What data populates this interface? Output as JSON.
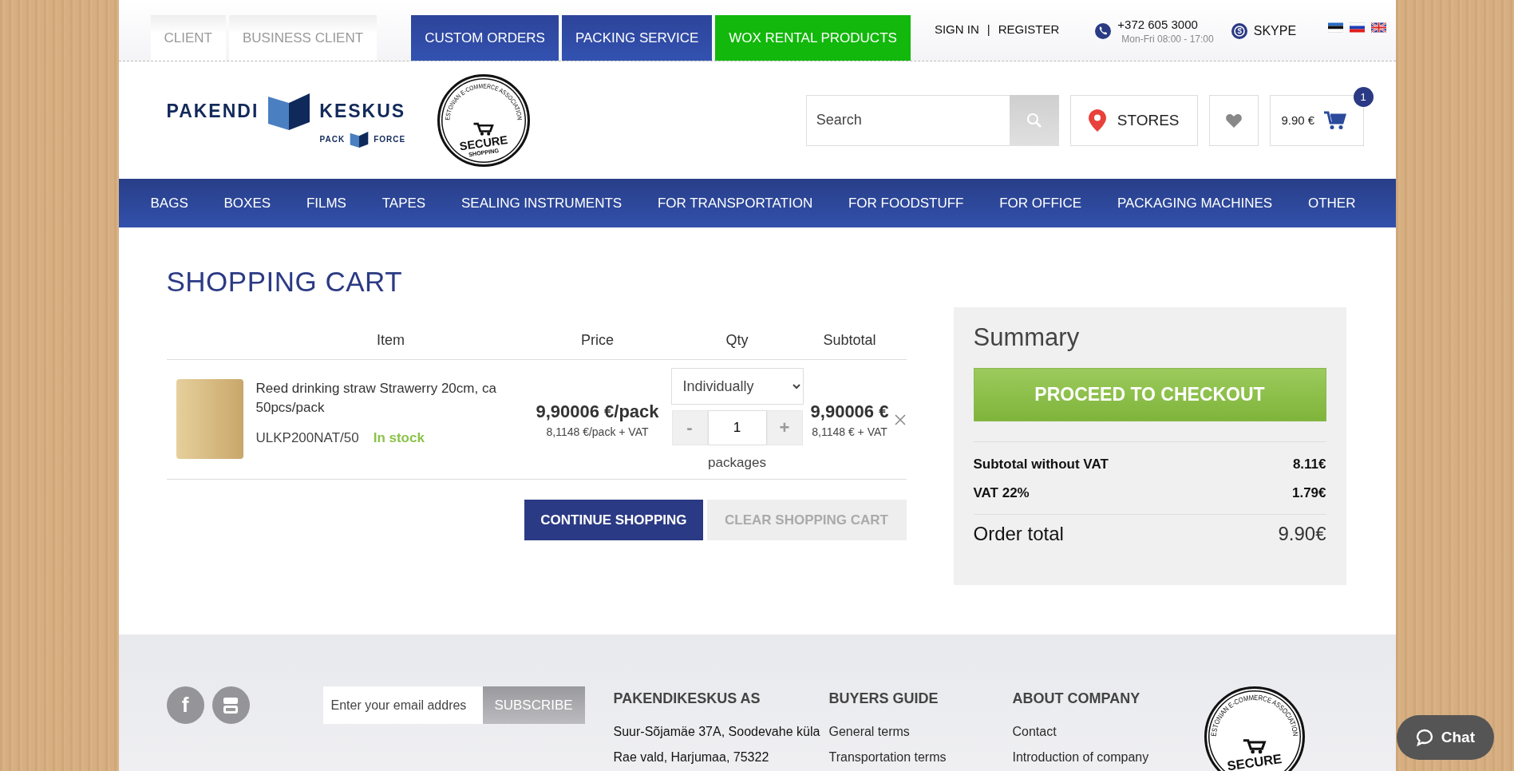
{
  "top_tabs": [
    {
      "label": "CLIENT",
      "kind": "client"
    },
    {
      "label": "BUSINESS CLIENT",
      "kind": "client"
    },
    {
      "label": "CUSTOM ORDERS",
      "kind": "service"
    },
    {
      "label": "PACKING SERVICE",
      "kind": "service"
    },
    {
      "label": "WOX RENTAL PRODUCTS",
      "kind": "promo"
    }
  ],
  "account": {
    "sign_in": "SIGN IN",
    "separator": "|",
    "register": "REGISTER"
  },
  "contact": {
    "phone": "+372 605 3000",
    "hours": "Mon-Fri 08:00 - 17:00",
    "skype": "SKYPE"
  },
  "languages": [
    {
      "kind": "et"
    },
    {
      "kind": "ru"
    },
    {
      "kind": "en"
    }
  ],
  "logo": {
    "word_left": "PAKENDI",
    "word_right": "KESKUS",
    "sub_left": "PACK",
    "sub_right": "FORCE"
  },
  "secure_badge": {
    "ring_text": "ESTONIAN E-COMMERCE ASSOCIATION",
    "title": "SECURE",
    "subtitle": "SHOPPING"
  },
  "search": {
    "placeholder": "Search"
  },
  "stores": "STORES",
  "cart": {
    "total": "9.90 €",
    "count": "1"
  },
  "nav": [
    "BAGS",
    "BOXES",
    "FILMS",
    "TAPES",
    "SEALING INSTRUMENTS",
    "FOR TRANSPORTATION",
    "FOR FOODSTUFF",
    "FOR OFFICE",
    "PACKAGING MACHINES",
    "OTHER"
  ],
  "shopping_cart": {
    "title": "SHOPPING CART",
    "columns": [
      "Item",
      "Price",
      "Qty",
      "Subtotal"
    ],
    "items": [
      {
        "name": "Reed drinking straw Strawerry 20cm, ca 50pcs/pack",
        "sku": "ULKP200NAT/50",
        "stock": "In stock",
        "in_stock": true,
        "unit": "Individually",
        "minus": "-",
        "quantity": "1",
        "plus": "+",
        "quantity_unit": "packages",
        "price": "9,90006 €/pack",
        "price_vat": "8,1148 €/pack + VAT",
        "subtotal": "9,90006 €",
        "subtotal_vat": "8,1148 € + VAT"
      }
    ],
    "continue": "CONTINUE SHOPPING",
    "clear": "CLEAR SHOPPING CART"
  },
  "summary": {
    "title": "Summary",
    "checkout": "PROCEED TO CHECKOUT",
    "lines": [
      {
        "label": "Subtotal without VAT",
        "value": "8.11€"
      },
      {
        "label": "VAT 22%",
        "value": "1.79€"
      }
    ],
    "total": {
      "label": "Order total",
      "value": "9.90€"
    }
  },
  "footer": {
    "social": [
      {
        "kind": "facebook",
        "glyph": "f"
      },
      {
        "kind": "youtube"
      }
    ],
    "newsletter": {
      "placeholder": "Enter your email addres",
      "button": "SUBSCRIBE"
    },
    "columns": [
      {
        "title": "PAKENDIKESKUS AS",
        "links": [
          "Suur-Sõjamäe 37A, Soodevahe küla",
          "Rae vald, Harjumaa, 75322"
        ],
        "kind": "text"
      },
      {
        "title": "BUYERS GUIDE",
        "links": [
          "General terms",
          "Transportation terms"
        ],
        "kind": "links"
      },
      {
        "title": "ABOUT COMPANY",
        "links": [
          "Contact",
          "Introduction of company"
        ],
        "kind": "links"
      }
    ],
    "badge": {
      "ring_text": "ESTONIAN E-COMMERCE ASSOCIATION",
      "title": "SECURE"
    }
  },
  "chat": "Chat"
}
